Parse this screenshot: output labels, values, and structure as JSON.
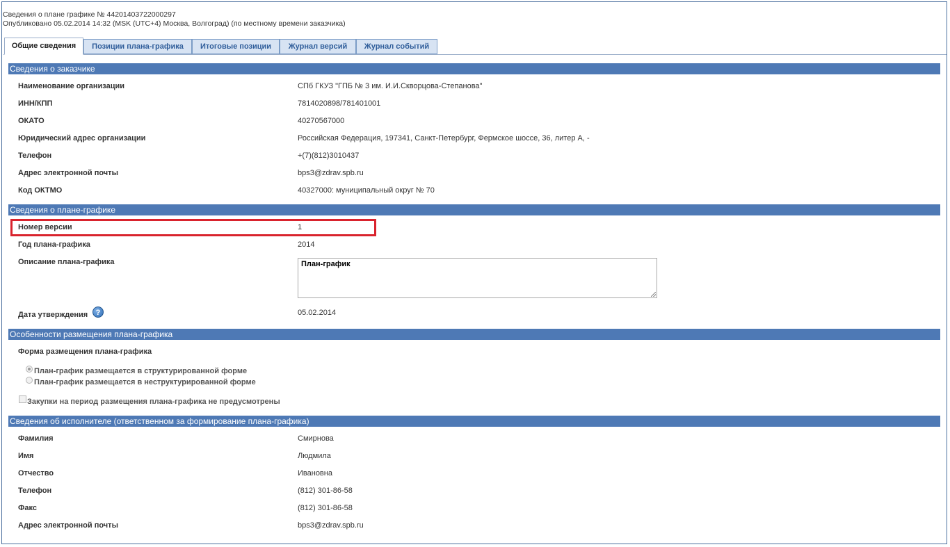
{
  "header": {
    "title": "Сведения о плане графике № 44201403722000297",
    "published": "Опубликовано 05.02.2014 14:32 (MSK (UTC+4) Москва, Волгоград) (по местному времени заказчика)"
  },
  "tabs": [
    {
      "label": "Общие сведения",
      "active": true
    },
    {
      "label": "Позиции плана-графика",
      "active": false
    },
    {
      "label": "Итоговые позиции",
      "active": false
    },
    {
      "label": "Журнал версий",
      "active": false
    },
    {
      "label": "Журнал событий",
      "active": false
    }
  ],
  "customer": {
    "title": "Сведения о заказчике",
    "rows": [
      {
        "label": "Наименование организации",
        "value": "СПб ГКУЗ \"ГПБ № 3 им. И.И.Скворцова-Степанова\""
      },
      {
        "label": "ИНН/КПП",
        "value": "7814020898/781401001"
      },
      {
        "label": "ОКАТО",
        "value": "40270567000"
      },
      {
        "label": "Юридический адрес организации",
        "value": "Российская Федерация, 197341, Санкт-Петербург, Фермское шоссе, 36, литер А, -"
      },
      {
        "label": "Телефон",
        "value": "+(7)(812)3010437"
      },
      {
        "label": "Адрес электронной почты",
        "value": "bps3@zdrav.spb.ru"
      },
      {
        "label": "Код ОКТМО",
        "value": "40327000: муниципальный округ № 70"
      }
    ]
  },
  "plan": {
    "title": "Сведения о плане-графике",
    "version_label": "Номер версии",
    "version_value": "1",
    "year_label": "Год плана-графика",
    "year_value": "2014",
    "description_label": "Описание плана-графика",
    "description_value": "План-график",
    "approval_label": "Дата утверждения",
    "approval_value": "05.02.2014",
    "help_icon": "question-circle-icon"
  },
  "placement": {
    "title": "Особенности размещения плана-графика",
    "form_label": "Форма размещения плана-графика",
    "option_structured": "План-график размещается в структурированной форме",
    "option_unstructured": "План-график размещается в неструктурированной форме",
    "selected": "structured",
    "no_purchases_label": "Закупки на период размещения плана-графика не предусмотрены",
    "no_purchases_checked": false
  },
  "executor": {
    "title": "Сведения об исполнителе (ответственном за формирование плана-графика)",
    "rows": [
      {
        "label": "Фамилия",
        "value": "Смирнова"
      },
      {
        "label": "Имя",
        "value": "Людмила"
      },
      {
        "label": "Отчество",
        "value": "Ивановна"
      },
      {
        "label": "Телефон",
        "value": "(812) 301-86-58"
      },
      {
        "label": "Факс",
        "value": "(812) 301-86-58"
      },
      {
        "label": "Адрес электронной почты",
        "value": "bps3@zdrav.spb.ru"
      }
    ]
  },
  "colors": {
    "section_bar": "#4e79b5",
    "tab_inactive_bg": "#d7e3f3",
    "highlight_border": "#d9232d"
  }
}
